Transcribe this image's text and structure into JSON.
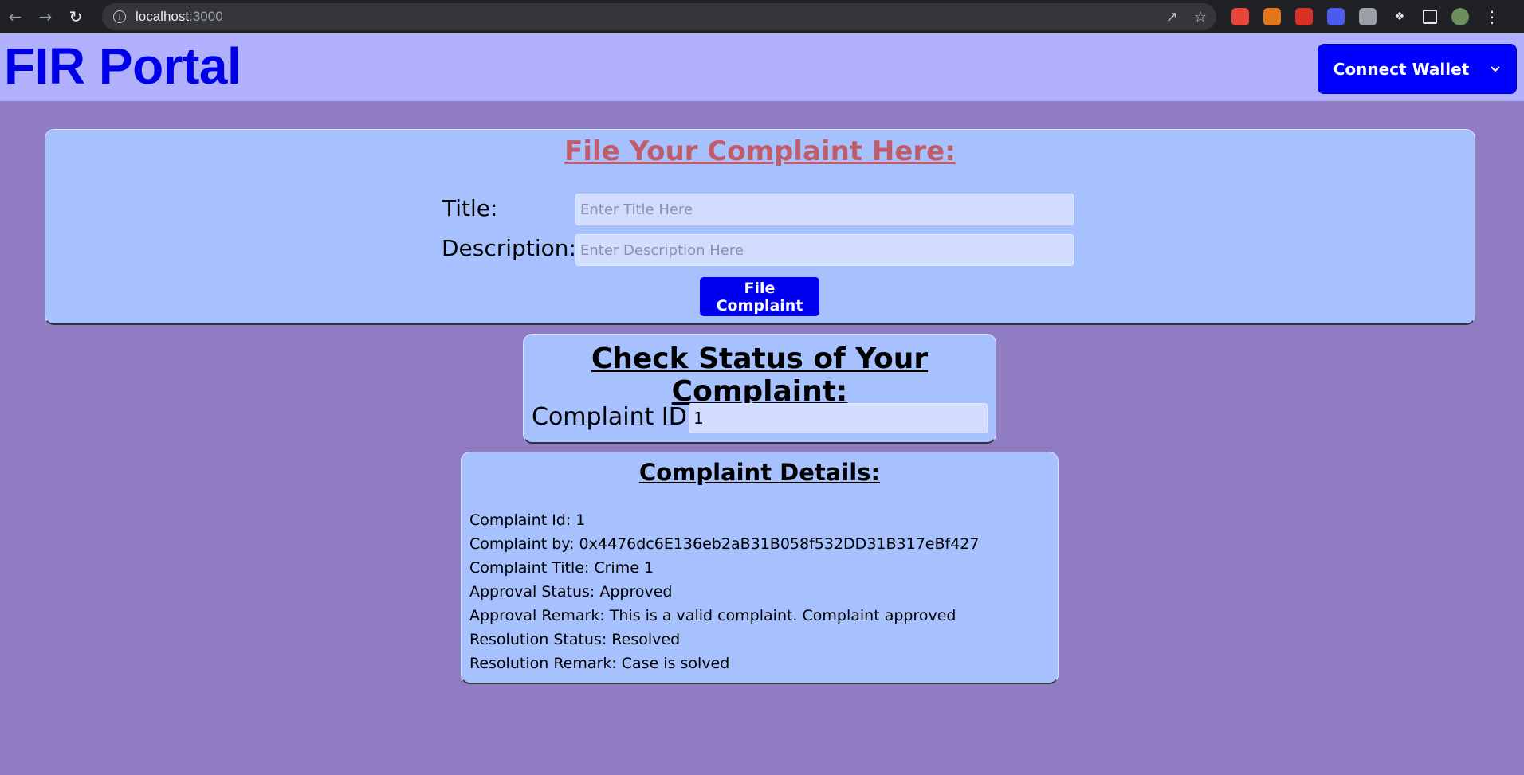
{
  "browser": {
    "url_host": "localhost",
    "url_port": ":3000",
    "extensions": [
      {
        "name": "color-picker-extension-icon",
        "color": "#e8453c"
      },
      {
        "name": "metamask-fox-icon",
        "color": "#e2761b"
      },
      {
        "name": "red-extension-icon",
        "color": "#d93025"
      },
      {
        "name": "blue-gear-extension-icon",
        "color": "#4b5bf0"
      },
      {
        "name": "gray-extension-icon",
        "color": "#9aa0a6"
      }
    ]
  },
  "header": {
    "title": "FIR Portal",
    "connect_wallet_label": "Connect Wallet"
  },
  "file_complaint": {
    "heading": "File Your Complaint Here:",
    "title_label": "Title:",
    "title_placeholder": "Enter Title Here",
    "description_label": "Description:",
    "description_placeholder": "Enter Description Here",
    "submit_label": "File Complaint"
  },
  "check_status": {
    "heading": "Check Status of Your Complaint:",
    "id_label": "Complaint ID:",
    "id_value": "1"
  },
  "complaint_details": {
    "heading": "Complaint Details:",
    "lines": [
      "Complaint Id: 1",
      "Complaint by: 0x4476dc6E136eb2aB31B058f532DD31B317eBf427",
      "Complaint Title: Crime 1",
      "Approval Status: Approved",
      "Approval Remark: This is a valid complaint. Complaint approved",
      "Resolution Status: Resolved",
      "Resolution Remark: Case is solved"
    ]
  },
  "colors": {
    "page_background": "#8f7cc3",
    "header_background": "#b0b0fd",
    "card_background": "#a6c1fd",
    "primary_button": "#0000ff",
    "title_color": "#0000e6",
    "file_heading_color": "#c05d6c"
  }
}
